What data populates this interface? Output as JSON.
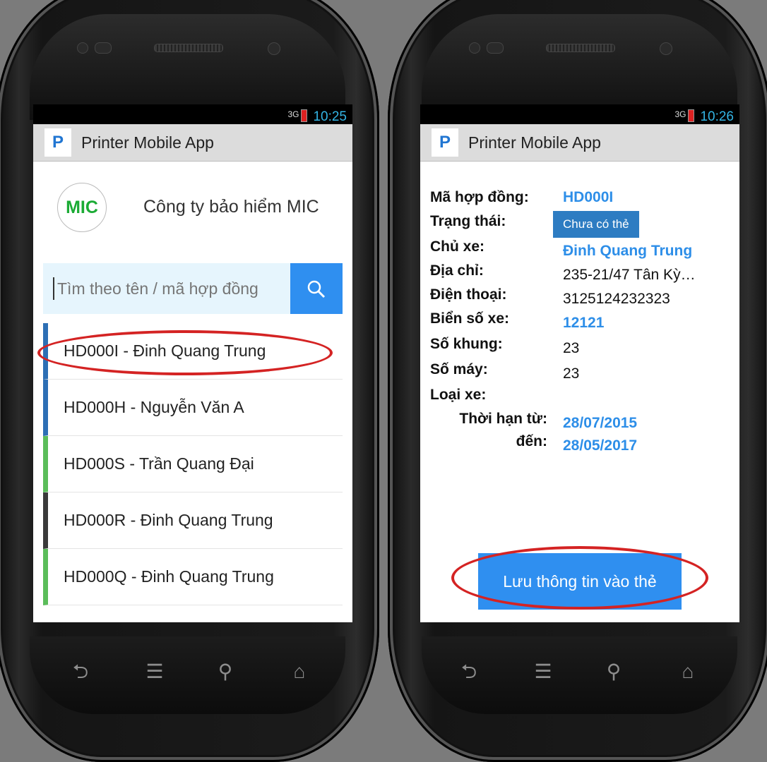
{
  "left": {
    "status": {
      "signal": "3G",
      "time": "10:25"
    },
    "app_title": "Printer Mobile App",
    "app_logo": "P",
    "company": {
      "logo": "MIC",
      "name": "Công ty bảo hiểm MIC"
    },
    "search": {
      "placeholder": "Tìm theo tên / mã hợp đồng",
      "icon": "search-icon"
    },
    "items": [
      {
        "label": "HD000I - Đinh Quang Trung",
        "color": "#2d6fb5"
      },
      {
        "label": "HD000H - Nguyễn Văn A",
        "color": "#2d6fb5"
      },
      {
        "label": "HD000S - Trần Quang Đại",
        "color": "#5bbd5a"
      },
      {
        "label": "HD000R - Đinh Quang Trung",
        "color": "#3a3a3a"
      },
      {
        "label": "HD000Q - Đinh Quang Trung",
        "color": "#5bbd5a"
      }
    ]
  },
  "right": {
    "status": {
      "signal": "3G",
      "time": "10:26"
    },
    "app_title": "Printer Mobile App",
    "app_logo": "P",
    "fields": {
      "contract_label": "Mã hợp đồng:",
      "contract_value": "HD000I",
      "status_label": "Trạng thái:",
      "status_value": "Chưa có thẻ",
      "owner_label": "Chủ xe:",
      "owner_value": "Đinh Quang Trung",
      "address_label": "Địa chỉ:",
      "address_value": "235-21/47 Tân Kỳ…",
      "phone_label": "Điện thoại:",
      "phone_value": "3125124232323",
      "plate_label": "Biển số xe:",
      "plate_value": "12121",
      "frame_label": "Số khung:",
      "frame_value": "23",
      "engine_label": "Số máy:",
      "engine_value": "23",
      "type_label": "Loại xe:",
      "from_label": "Thời hạn từ:",
      "from_value": "28/07/2015",
      "to_label": "đến:",
      "to_value": "28/05/2017"
    },
    "save_button": "Lưu thông tin vào thẻ"
  },
  "colors": {
    "accent": "#2f8ff0",
    "highlight": "#d42323"
  }
}
